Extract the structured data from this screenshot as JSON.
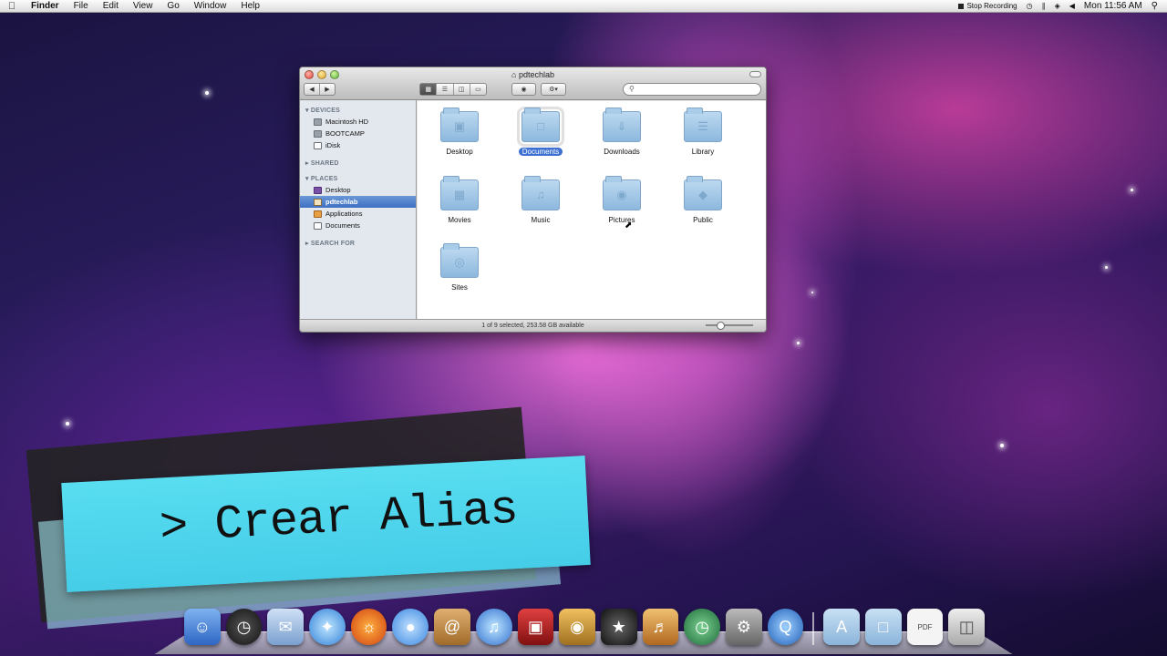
{
  "menubar": {
    "app": "Finder",
    "menus": [
      "File",
      "Edit",
      "View",
      "Go",
      "Window",
      "Help"
    ],
    "stop_recording": "Stop Recording",
    "clock": "Mon 11:56 AM"
  },
  "finder": {
    "title": "pdtechlab",
    "search_placeholder": "",
    "sidebar": {
      "devices_label": "DEVICES",
      "devices": [
        "Macintosh HD",
        "BOOTCAMP",
        "iDisk"
      ],
      "shared_label": "SHARED",
      "places_label": "PLACES",
      "places": [
        "Desktop",
        "pdtechlab",
        "Applications",
        "Documents"
      ],
      "search_for_label": "SEARCH FOR"
    },
    "items": [
      "Desktop",
      "Documents",
      "Downloads",
      "Library",
      "Movies",
      "Music",
      "Pictures",
      "Public",
      "Sites"
    ],
    "selected_item": "Documents",
    "status": "1 of 9 selected, 253.58 GB available"
  },
  "banner": {
    "text": "> Crear Alias"
  },
  "dock": {
    "apps": [
      "Finder",
      "Dashboard",
      "Mail",
      "Safari",
      "Firefox",
      "iChat",
      "Address Book",
      "iTunes",
      "Photo Booth",
      "iPhoto",
      "iMovie",
      "GarageBand",
      "Time Machine",
      "System Preferences",
      "QuickTime"
    ],
    "stacks": [
      "Applications",
      "Documents",
      "PDF",
      "Trash"
    ]
  },
  "colors": {
    "selection": "#3c6fd1",
    "banner": "#45cde8"
  }
}
